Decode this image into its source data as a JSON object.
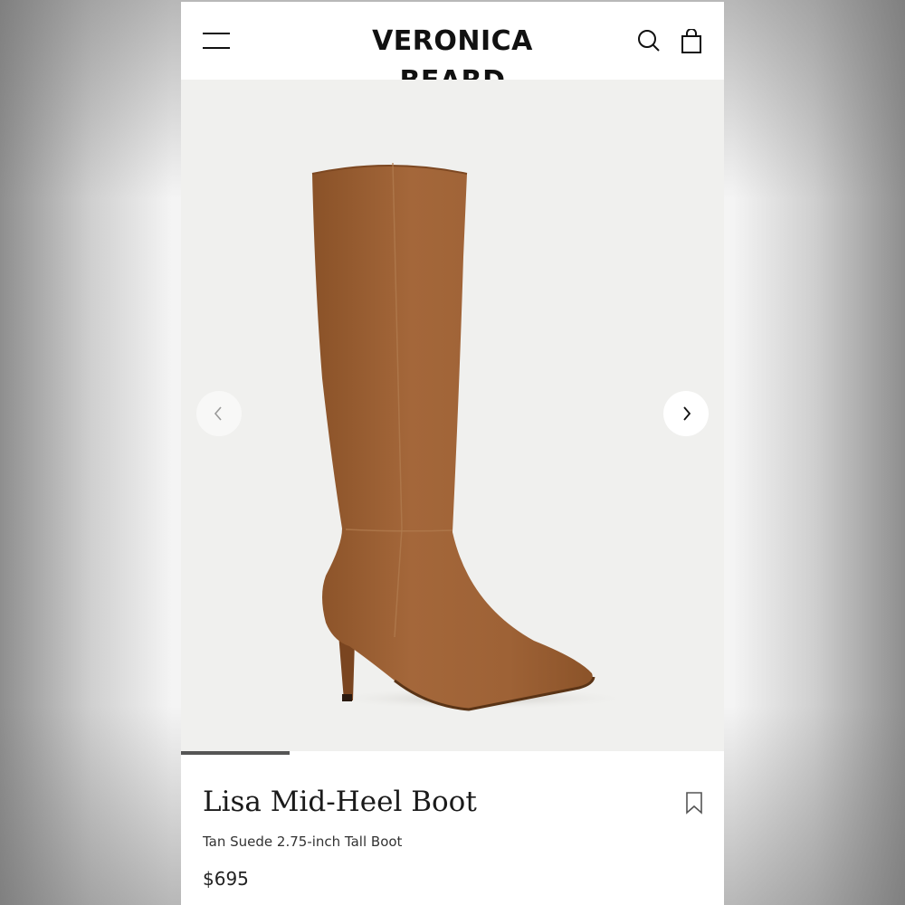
{
  "header": {
    "brand": "VERONICA BEARD",
    "menu_icon": "hamburger-menu-icon",
    "search_icon": "search-icon",
    "cart_icon": "shopping-bag-icon"
  },
  "gallery": {
    "image_alt": "Lisa Mid-Heel Boot",
    "prev_icon": "chevron-left-icon",
    "next_icon": "chevron-right-icon",
    "progress_fraction": 0.2
  },
  "product": {
    "title": "Lisa Mid-Heel Boot",
    "subtitle": "Tan Suede 2.75-inch Tall Boot",
    "price": "$695",
    "wishlist_icon": "bookmark-icon"
  },
  "colors": {
    "boot": "#9c6034",
    "gallery_bg": "#f0f0ee",
    "text": "#1a1a1a"
  }
}
